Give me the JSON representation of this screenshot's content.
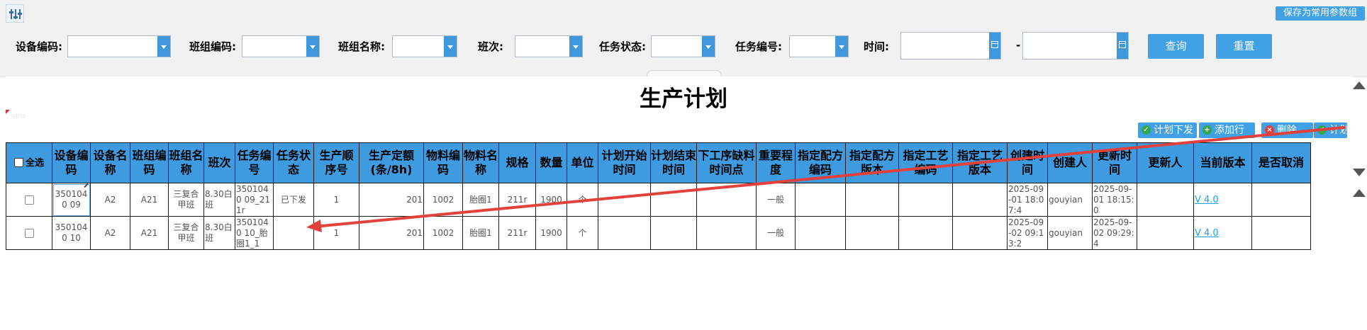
{
  "toolbar": {
    "save_params_label": "保存为常用参数组"
  },
  "filters": {
    "equipment_code_label": "设备编码:",
    "team_code_label": "班组编码:",
    "team_name_label": "班组名称:",
    "shift_label": "班次:",
    "task_status_label": "任务状态:",
    "task_no_label": "任务编号:",
    "time_label": "时间:",
    "range_sep": "-",
    "query_label": "查询",
    "reset_label": "重置"
  },
  "page": {
    "title": "生产计划",
    "watermark": "sim"
  },
  "actions": {
    "issue_plan": "计划下发",
    "add_row": "添加行",
    "delete": "删除",
    "plan": "计划"
  },
  "table": {
    "select_all": "全选",
    "headers": [
      "设备编码",
      "设备名称",
      "班组编码",
      "班组名称",
      "班次",
      "任务编号",
      "任务状态",
      "生产顺序号",
      "生产定额(条/8h)",
      "物料编码",
      "物料名称",
      "规格",
      "数量",
      "单位",
      "计划开始时间",
      "计划结束时间",
      "下工序缺料时间点",
      "重要程度",
      "指定配方编码",
      "指定配方版本",
      "指定工艺编码",
      "指定工艺版本",
      "创建时间",
      "创建人",
      "更新时间",
      "更新人",
      "当前版本",
      "是否取消"
    ],
    "rows": [
      [
        "3501040 09",
        "A2",
        "A21",
        "三复合甲班",
        "8.30白班",
        "3501040 09_211r",
        "已下发",
        "1",
        "201",
        "1002",
        "胎圈1",
        "211r",
        "1900",
        "个",
        "",
        "",
        "",
        "一般",
        "",
        "",
        "",
        "",
        "2025-09-01 18:07:4",
        "gouyian",
        "2025-09-01 18:15:0",
        "",
        "V 4.0",
        ""
      ],
      [
        "3501040 10",
        "A2",
        "A21",
        "三复合甲班",
        "8.30白班",
        "3501040 10_胎圈1_1",
        "",
        "1",
        "201",
        "1002",
        "胎圈1",
        "211r",
        "1900",
        "个",
        "",
        "",
        "",
        "一般",
        "",
        "",
        "",
        "",
        "2025-09-02 09:13:2",
        "gouyian",
        "2025-09-02 09:29:4",
        "",
        "V 4.0",
        ""
      ]
    ]
  },
  "colors": {
    "accent": "#41a1e6",
    "header_bg": "#3f9be0",
    "annotation_arrow": "#e2413c"
  },
  "icons": [
    "filter-sliders-icon",
    "chevron-down-icon",
    "calendar-icon",
    "check-icon",
    "plus-icon",
    "delete-x-icon",
    "scroll-up-icon",
    "scroll-down-icon"
  ]
}
